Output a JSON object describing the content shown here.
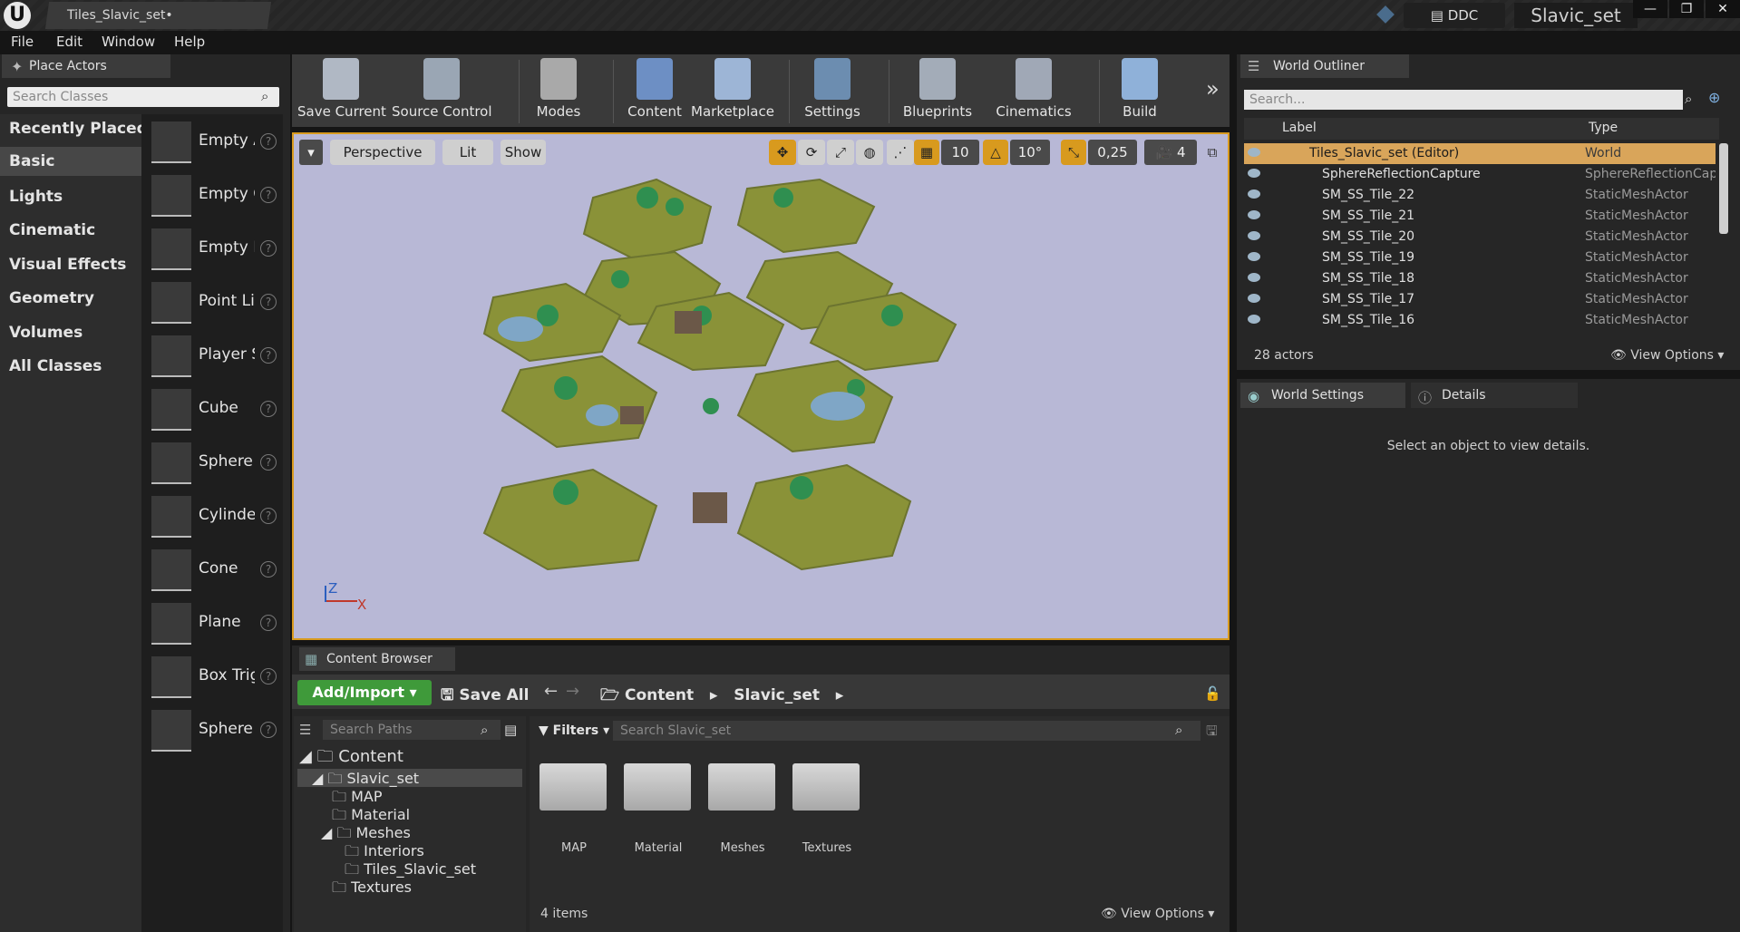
{
  "window": {
    "tab_title": "Tiles_Slavic_set•",
    "ddc_label": "DDC",
    "project_name": "Slavic_set",
    "logo_text": "U"
  },
  "menu": [
    "File",
    "Edit",
    "Window",
    "Help"
  ],
  "place_actors": {
    "tab_label": "Place Actors",
    "search_placeholder": "Search Classes",
    "categories": [
      "Recently Placed",
      "Basic",
      "Lights",
      "Cinematic",
      "Visual Effects",
      "Geometry",
      "Volumes",
      "All Classes"
    ],
    "selected_category": "Basic",
    "actors": [
      "Empty Actor",
      "Empty Character",
      "Empty Pawn",
      "Point Light",
      "Player Start",
      "Cube",
      "Sphere",
      "Cylinder",
      "Cone",
      "Plane",
      "Box Trigger",
      "Sphere Trigger"
    ]
  },
  "toolbar": {
    "buttons": [
      "Save Current",
      "Source Control",
      "Modes",
      "Content",
      "Marketplace",
      "Settings",
      "Blueprints",
      "Cinematics",
      "Build"
    ],
    "overflow": "»"
  },
  "viewport": {
    "view_mode": "Perspective",
    "lighting": "Lit",
    "show_label": "Show",
    "grid_snap": "10",
    "rotation_snap": "10°",
    "scale_snap": "0,25",
    "camera_speed": "4",
    "axis_z": "Z",
    "axis_x": "X"
  },
  "content_browser": {
    "tab_label": "Content Browser",
    "add_import": "Add/Import",
    "save_all": "Save All",
    "breadcrumb": [
      "Content",
      "Slavic_set"
    ],
    "path_search_placeholder": "Search Paths",
    "filters_label": "Filters",
    "asset_search_placeholder": "Search Slavic_set",
    "tree": [
      {
        "label": "Content",
        "depth": 0
      },
      {
        "label": "Slavic_set",
        "depth": 1
      },
      {
        "label": "MAP",
        "depth": 2
      },
      {
        "label": "Material",
        "depth": 2
      },
      {
        "label": "Meshes",
        "depth": 2
      },
      {
        "label": "Interiors",
        "depth": 3
      },
      {
        "label": "Tiles_Slavic_set",
        "depth": 3
      },
      {
        "label": "Textures",
        "depth": 2
      }
    ],
    "folders": [
      "MAP",
      "Material",
      "Meshes",
      "Textures"
    ],
    "item_count": "4 items",
    "view_options": "View Options"
  },
  "outliner": {
    "tab_label": "World Outliner",
    "search_placeholder": "Search...",
    "col_label": "Label",
    "col_type": "Type",
    "rows": [
      {
        "label": "Tiles_Slavic_set (Editor)",
        "type": "World"
      },
      {
        "label": "SphereReflectionCapture",
        "type": "SphereReflectionCapture"
      },
      {
        "label": "SM_SS_Tile_22",
        "type": "StaticMeshActor"
      },
      {
        "label": "SM_SS_Tile_21",
        "type": "StaticMeshActor"
      },
      {
        "label": "SM_SS_Tile_20",
        "type": "StaticMeshActor"
      },
      {
        "label": "SM_SS_Tile_19",
        "type": "StaticMeshActor"
      },
      {
        "label": "SM_SS_Tile_18",
        "type": "StaticMeshActor"
      },
      {
        "label": "SM_SS_Tile_17",
        "type": "StaticMeshActor"
      },
      {
        "label": "SM_SS_Tile_16",
        "type": "StaticMeshActor"
      }
    ],
    "actor_count": "28 actors",
    "view_options": "View Options"
  },
  "details": {
    "world_settings_tab": "World Settings",
    "details_tab": "Details",
    "empty_message": "Select an object to view details."
  },
  "colors": {
    "accent_orange": "#d89a1e",
    "add_import_green": "#3f9a3a",
    "selected_row": "#d9a55a"
  }
}
